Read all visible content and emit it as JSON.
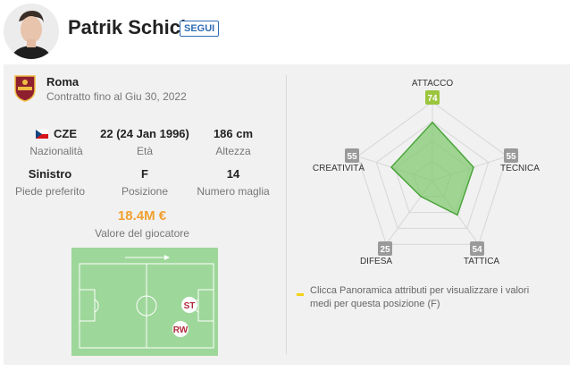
{
  "player": {
    "name": "Patrik Schick",
    "follow_label": "SEGUI"
  },
  "club": {
    "name": "Roma",
    "contract": "Contratto fino al Giu 30, 2022"
  },
  "stats": {
    "nationality": {
      "value": "CZE",
      "label": "Nazionalità"
    },
    "age": {
      "value": "22 (24 Jan 1996)",
      "label": "Età"
    },
    "height": {
      "value": "186 cm",
      "label": "Altezza"
    },
    "foot": {
      "value": "Sinistro",
      "label": "Piede preferito"
    },
    "position": {
      "value": "F",
      "label": "Posizione"
    },
    "shirt": {
      "value": "14",
      "label": "Numero maglia"
    }
  },
  "market_value": {
    "amount": "18.4M €",
    "label": "Valore del giocatore"
  },
  "pitch": {
    "positions": [
      "ST",
      "RW"
    ]
  },
  "attributes": {
    "attacco": {
      "label": "ATTACCO",
      "value": 74
    },
    "tecnica": {
      "label": "TECNICA",
      "value": 55
    },
    "tattica": {
      "label": "TATTICA",
      "value": 54
    },
    "difesa": {
      "label": "DIFESA",
      "value": 25
    },
    "creativita": {
      "label": "CREATIVITÀ",
      "value": 55
    }
  },
  "legend": {
    "text": "Clicca Panoramica attributi per visualizzare i valori medi per questa posizione (F)"
  },
  "colors": {
    "accent_blue": "#2f6db5",
    "value_orange": "#f0a030",
    "radar_fill": "#7cc76a",
    "radar_stroke": "#4aa53a",
    "badge_grey": "#9a9a9a",
    "badge_green": "#9bc53d",
    "pitch_green": "#9ed79a",
    "legend_yellow": "#f2d21b"
  }
}
